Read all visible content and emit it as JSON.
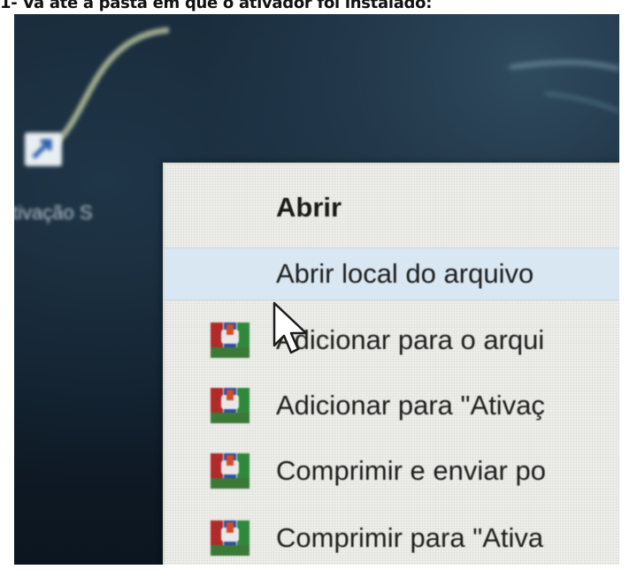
{
  "caption": "1- Vá até a pasta em que o ativador foi instalado:",
  "desktop": {
    "shortcut_label": "tivação S",
    "shortcut_icon": "shortcut-arrow-icon",
    "background_color": "#152636"
  },
  "context_menu": {
    "hovered_item": "Abrir local do arquivo",
    "hover_color": "#d8e7f2",
    "items": [
      {
        "label": "Abrir",
        "bold": true,
        "icon": null
      },
      {
        "label": "Abrir local do arquivo",
        "bold": false,
        "icon": null
      },
      {
        "label": "Adicionar para o arqui",
        "bold": false,
        "icon": "winrar-icon"
      },
      {
        "label": "Adicionar para \"Ativaç",
        "bold": false,
        "icon": "winrar-icon"
      },
      {
        "label": "Comprimir e enviar po",
        "bold": false,
        "icon": "winrar-icon"
      },
      {
        "label": "Comprimir para \"Ativa",
        "bold": false,
        "icon": "winrar-icon"
      }
    ]
  },
  "cursor_icon": "mouse-pointer-icon"
}
